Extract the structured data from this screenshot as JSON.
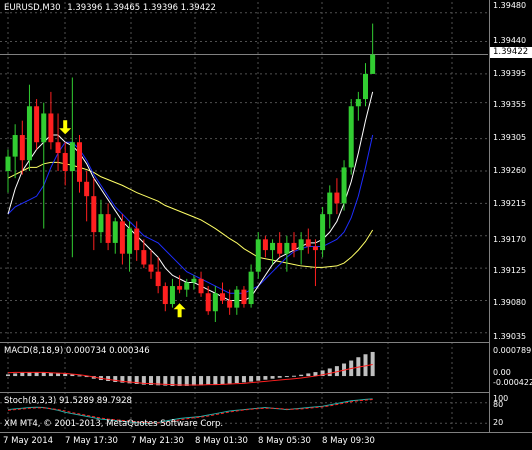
{
  "header": {
    "symbol_label": "EURUSD,M30",
    "ohlc": "1.39396 1.39465 1.39396 1.39422"
  },
  "main_axis": {
    "ticks": [
      "1.39480",
      "1.39440",
      "1.39395",
      "1.39355",
      "1.39305",
      "1.39260",
      "1.39215",
      "1.39170",
      "1.39125",
      "1.39080",
      "1.39035"
    ],
    "current_price": "1.39422"
  },
  "macd": {
    "label": "MACD(8,18,9) 0.000734 0.000346",
    "ticks": [
      "0.000789",
      "0.00",
      "-0.000422"
    ]
  },
  "stoch": {
    "label": "Stoch(8,3,3) 91.5289 89.7928",
    "ticks": [
      "100",
      "80",
      "20"
    ]
  },
  "footer": {
    "copyright": "XM MT4, © 2001-2013, MetaQuotes Software Corp."
  },
  "time_axis": [
    "7 May 2014",
    "7 May 17:30",
    "7 May 21:30",
    "8 May 01:30",
    "8 May 05:30",
    "8 May 09:30"
  ],
  "colors": {
    "bull": "#32cd32",
    "bear": "#ff2020",
    "fast_ma": "#ffffff",
    "mid_ma": "#ffff66",
    "slow_ma": "#1e2dff",
    "arrow": "#ffff00",
    "grid": "#505050"
  },
  "chart_data": {
    "type": "candlestick",
    "ylim": [
      1.39025,
      1.39495
    ],
    "last_price": 1.39422,
    "candles": [
      {
        "o": 1.3926,
        "h": 1.3929,
        "l": 1.3923,
        "c": 1.3928
      },
      {
        "o": 1.3928,
        "h": 1.39325,
        "l": 1.3925,
        "c": 1.3931
      },
      {
        "o": 1.3931,
        "h": 1.3933,
        "l": 1.39255,
        "c": 1.39275
      },
      {
        "o": 1.39275,
        "h": 1.3938,
        "l": 1.3926,
        "c": 1.3935
      },
      {
        "o": 1.3935,
        "h": 1.3936,
        "l": 1.3929,
        "c": 1.393
      },
      {
        "o": 1.393,
        "h": 1.39355,
        "l": 1.3918,
        "c": 1.3934
      },
      {
        "o": 1.3934,
        "h": 1.3937,
        "l": 1.3929,
        "c": 1.393
      },
      {
        "o": 1.393,
        "h": 1.3934,
        "l": 1.3926,
        "c": 1.39285
      },
      {
        "o": 1.39285,
        "h": 1.393,
        "l": 1.3924,
        "c": 1.3926
      },
      {
        "o": 1.3926,
        "h": 1.3939,
        "l": 1.3914,
        "c": 1.393
      },
      {
        "o": 1.393,
        "h": 1.3931,
        "l": 1.3923,
        "c": 1.39245
      },
      {
        "o": 1.39245,
        "h": 1.3926,
        "l": 1.3919,
        "c": 1.39225
      },
      {
        "o": 1.39225,
        "h": 1.3925,
        "l": 1.3915,
        "c": 1.39175
      },
      {
        "o": 1.39175,
        "h": 1.3922,
        "l": 1.3916,
        "c": 1.392
      },
      {
        "o": 1.392,
        "h": 1.39215,
        "l": 1.3915,
        "c": 1.3916
      },
      {
        "o": 1.3916,
        "h": 1.39195,
        "l": 1.39145,
        "c": 1.3919
      },
      {
        "o": 1.3919,
        "h": 1.392,
        "l": 1.3913,
        "c": 1.39145
      },
      {
        "o": 1.39145,
        "h": 1.3919,
        "l": 1.3912,
        "c": 1.3918
      },
      {
        "o": 1.3918,
        "h": 1.3919,
        "l": 1.39135,
        "c": 1.3915
      },
      {
        "o": 1.3915,
        "h": 1.39165,
        "l": 1.39125,
        "c": 1.3913
      },
      {
        "o": 1.3913,
        "h": 1.3915,
        "l": 1.3911,
        "c": 1.3912
      },
      {
        "o": 1.3912,
        "h": 1.3914,
        "l": 1.3909,
        "c": 1.391
      },
      {
        "o": 1.391,
        "h": 1.39105,
        "l": 1.39065,
        "c": 1.39075
      },
      {
        "o": 1.39075,
        "h": 1.3911,
        "l": 1.3907,
        "c": 1.391
      },
      {
        "o": 1.391,
        "h": 1.39115,
        "l": 1.3909,
        "c": 1.39095
      },
      {
        "o": 1.39095,
        "h": 1.3911,
        "l": 1.39085,
        "c": 1.39105
      },
      {
        "o": 1.39105,
        "h": 1.39115,
        "l": 1.39095,
        "c": 1.3911
      },
      {
        "o": 1.3911,
        "h": 1.3912,
        "l": 1.39085,
        "c": 1.3909
      },
      {
        "o": 1.3909,
        "h": 1.391,
        "l": 1.3906,
        "c": 1.39065
      },
      {
        "o": 1.39065,
        "h": 1.391,
        "l": 1.3905,
        "c": 1.3909
      },
      {
        "o": 1.3909,
        "h": 1.39105,
        "l": 1.39075,
        "c": 1.3908
      },
      {
        "o": 1.3908,
        "h": 1.39095,
        "l": 1.3906,
        "c": 1.3907
      },
      {
        "o": 1.3907,
        "h": 1.391,
        "l": 1.3906,
        "c": 1.39095
      },
      {
        "o": 1.39095,
        "h": 1.391,
        "l": 1.3907,
        "c": 1.39075
      },
      {
        "o": 1.39075,
        "h": 1.3913,
        "l": 1.3907,
        "c": 1.3912
      },
      {
        "o": 1.3912,
        "h": 1.39175,
        "l": 1.3911,
        "c": 1.39165
      },
      {
        "o": 1.39165,
        "h": 1.3917,
        "l": 1.3914,
        "c": 1.3915
      },
      {
        "o": 1.3915,
        "h": 1.39165,
        "l": 1.3913,
        "c": 1.3916
      },
      {
        "o": 1.3916,
        "h": 1.39175,
        "l": 1.3914,
        "c": 1.39145
      },
      {
        "o": 1.39145,
        "h": 1.3917,
        "l": 1.3912,
        "c": 1.3916
      },
      {
        "o": 1.3916,
        "h": 1.39175,
        "l": 1.3914,
        "c": 1.3915
      },
      {
        "o": 1.3915,
        "h": 1.39175,
        "l": 1.3913,
        "c": 1.39165
      },
      {
        "o": 1.39165,
        "h": 1.3918,
        "l": 1.39145,
        "c": 1.39155
      },
      {
        "o": 1.39155,
        "h": 1.39165,
        "l": 1.391,
        "c": 1.3915
      },
      {
        "o": 1.3915,
        "h": 1.3921,
        "l": 1.3914,
        "c": 1.392
      },
      {
        "o": 1.392,
        "h": 1.3924,
        "l": 1.3918,
        "c": 1.3923
      },
      {
        "o": 1.3923,
        "h": 1.3925,
        "l": 1.392,
        "c": 1.39215
      },
      {
        "o": 1.39215,
        "h": 1.39275,
        "l": 1.39205,
        "c": 1.39265
      },
      {
        "o": 1.39265,
        "h": 1.3936,
        "l": 1.39255,
        "c": 1.3935
      },
      {
        "o": 1.3935,
        "h": 1.3937,
        "l": 1.3933,
        "c": 1.3936
      },
      {
        "o": 1.3936,
        "h": 1.3941,
        "l": 1.3935,
        "c": 1.39395
      },
      {
        "o": 1.39395,
        "h": 1.39465,
        "l": 1.39396,
        "c": 1.39422
      }
    ],
    "fast_ma": [
      1.392,
      1.39235,
      1.3926,
      1.39275,
      1.3929,
      1.393,
      1.3931,
      1.3931,
      1.393,
      1.39295,
      1.39285,
      1.3927,
      1.3925,
      1.39235,
      1.3922,
      1.39205,
      1.3919,
      1.3918,
      1.3917,
      1.3916,
      1.3915,
      1.3914,
      1.39125,
      1.39115,
      1.3911,
      1.39105,
      1.39105,
      1.391,
      1.39095,
      1.3909,
      1.39085,
      1.3908,
      1.3908,
      1.3908,
      1.39085,
      1.391,
      1.39115,
      1.3913,
      1.3914,
      1.39145,
      1.3915,
      1.39155,
      1.3916,
      1.3916,
      1.39165,
      1.39175,
      1.3919,
      1.39215,
      1.39245,
      1.39285,
      1.3933,
      1.3937
    ],
    "mid_ma": [
      1.3925,
      1.39255,
      1.3926,
      1.39265,
      1.39265,
      1.3927,
      1.39272,
      1.39272,
      1.3927,
      1.39268,
      1.39265,
      1.39262,
      1.39258,
      1.39252,
      1.39248,
      1.39244,
      1.3924,
      1.39235,
      1.3923,
      1.39226,
      1.39222,
      1.39218,
      1.39212,
      1.39208,
      1.39204,
      1.392,
      1.39196,
      1.39192,
      1.39186,
      1.3918,
      1.39173,
      1.39166,
      1.3916,
      1.39152,
      1.39146,
      1.3914,
      1.39138,
      1.39136,
      1.39134,
      1.39132,
      1.3913,
      1.39128,
      1.39127,
      1.39126,
      1.39126,
      1.39127,
      1.39128,
      1.39132,
      1.3914,
      1.3915,
      1.39162,
      1.39178
    ],
    "slow_ma": [
      1.392,
      1.3921,
      1.39215,
      1.3922,
      1.39225,
      1.3924,
      1.39265,
      1.39285,
      1.393,
      1.393,
      1.3929,
      1.39275,
      1.39255,
      1.3924,
      1.39225,
      1.3921,
      1.392,
      1.3919,
      1.3918,
      1.3917,
      1.39165,
      1.3916,
      1.3915,
      1.3914,
      1.3913,
      1.3912,
      1.39115,
      1.3911,
      1.39105,
      1.391,
      1.39095,
      1.3909,
      1.3909,
      1.3909,
      1.39095,
      1.391,
      1.3911,
      1.3912,
      1.3913,
      1.3914,
      1.39148,
      1.39152,
      1.39155,
      1.39155,
      1.39155,
      1.3916,
      1.39165,
      1.39175,
      1.39195,
      1.39225,
      1.39265,
      1.3931
    ],
    "fractal_down_index": 8,
    "fractal_up_index": 24,
    "macd_hist": [
      5e-05,
      8e-05,
      0.0001,
      0.00012,
      0.00012,
      0.00011,
      0.0001,
      9e-05,
      7e-05,
      5e-05,
      2e-05,
      -3e-05,
      -8e-05,
      -0.00012,
      -0.00015,
      -0.00018,
      -0.0002,
      -0.00022,
      -0.00024,
      -0.00026,
      -0.00027,
      -0.00028,
      -0.00029,
      -0.0003,
      -0.0003,
      -0.0003,
      -0.00029,
      -0.00028,
      -0.00027,
      -0.00026,
      -0.00025,
      -0.00023,
      -0.00021,
      -0.00019,
      -0.00017,
      -0.00014,
      -0.00011,
      -8e-05,
      -5e-05,
      -2e-05,
      1e-05,
      4e-05,
      8e-05,
      0.00012,
      0.00017,
      0.00023,
      0.0003,
      0.00038,
      0.00047,
      0.00057,
      0.00066,
      0.00073
    ],
    "macd_signal": [
      0.0001,
      0.00011,
      0.00011,
      0.00011,
      0.00011,
      0.00011,
      0.0001,
      9e-05,
      8e-05,
      6e-05,
      4e-05,
      1e-05,
      -3e-05,
      -7e-05,
      -0.0001,
      -0.00013,
      -0.00016,
      -0.00018,
      -0.0002,
      -0.00022,
      -0.00023,
      -0.00024,
      -0.00025,
      -0.00026,
      -0.00027,
      -0.00027,
      -0.00027,
      -0.00027,
      -0.00026,
      -0.00026,
      -0.00025,
      -0.00024,
      -0.00023,
      -0.00022,
      -0.0002,
      -0.00018,
      -0.00016,
      -0.00014,
      -0.00012,
      -0.0001,
      -8e-05,
      -6e-05,
      -3e-05,
      0.0,
      4e-05,
      8e-05,
      0.00013,
      0.00018,
      0.00023,
      0.00027,
      0.00031,
      0.00035
    ],
    "stoch_main": [
      60,
      62,
      64,
      66,
      67,
      66,
      62,
      58,
      52,
      48,
      44,
      40,
      36,
      32,
      30,
      28,
      26,
      24,
      22,
      20,
      20,
      22,
      26,
      30,
      34,
      36,
      38,
      40,
      44,
      48,
      52,
      56,
      58,
      60,
      62,
      64,
      66,
      64,
      62,
      60,
      62,
      64,
      66,
      68,
      70,
      74,
      78,
      82,
      86,
      88,
      90,
      91.5
    ],
    "stoch_signal": [
      58,
      60,
      62,
      64,
      65,
      65,
      63,
      60,
      56,
      51,
      47,
      43,
      39,
      35,
      32,
      30,
      28,
      26,
      24,
      22,
      21,
      21,
      23,
      26,
      30,
      33,
      36,
      38,
      41,
      45,
      49,
      53,
      56,
      59,
      61,
      63,
      64,
      64,
      63,
      61,
      61,
      62,
      64,
      66,
      68,
      71,
      75,
      79,
      83,
      86,
      88,
      89.8
    ]
  }
}
